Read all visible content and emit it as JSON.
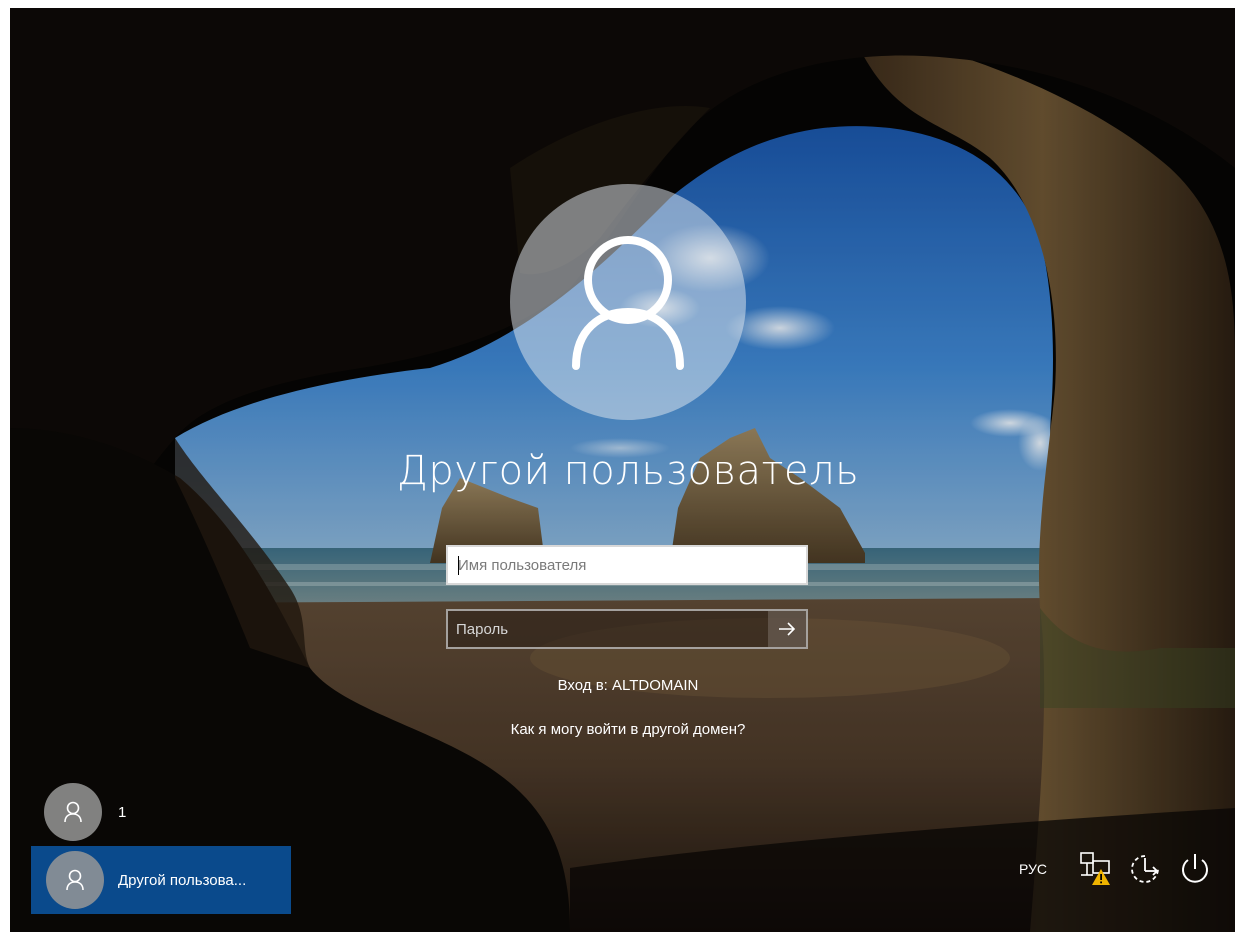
{
  "login": {
    "user_title": "Другой пользователь",
    "username_placeholder": "Имя пользователя",
    "password_placeholder": "Пароль",
    "submit_icon": "arrow-right-icon",
    "domain_label": "Вход в: ALTDOMAIN",
    "other_domain_link": "Как я могу войти в другой домен?"
  },
  "user_tiles": [
    {
      "name": "1",
      "icon": "person-icon"
    },
    {
      "name": "Другой пользова...",
      "icon": "person-icon",
      "selected": true
    }
  ],
  "tray": {
    "language": "РУС",
    "network_icon": "network-warning-icon",
    "accessibility_icon": "ease-of-access-icon",
    "power_icon": "power-icon"
  },
  "colors": {
    "selected_tile": "#0a4a8c",
    "text": "#ffffff",
    "warning": "#f0b400"
  }
}
